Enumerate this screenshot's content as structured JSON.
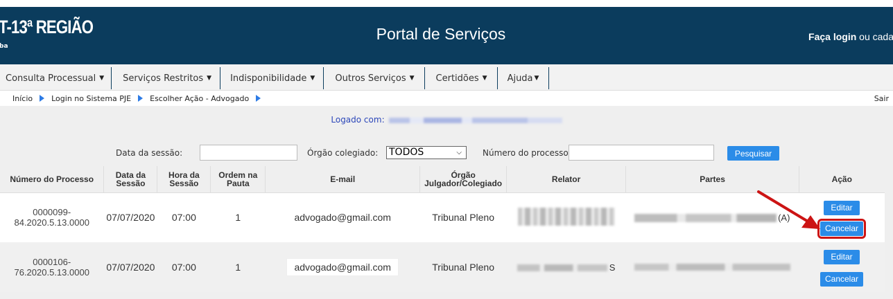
{
  "header": {
    "logo_text": "T-13ª REGIÃO",
    "logo_sub": "ba",
    "title": "Portal de Serviços",
    "login_bold": "Faça login",
    "login_rest": " ou cadas"
  },
  "nav": {
    "items": [
      {
        "label": "Consulta Processual"
      },
      {
        "label": "Serviços Restritos"
      },
      {
        "label": "Indisponibilidade"
      },
      {
        "label": "Outros Serviços"
      },
      {
        "label": "Certidões"
      },
      {
        "label": "Ajuda"
      }
    ]
  },
  "breadcrumb": {
    "items": [
      "Início",
      "Login no Sistema PJE",
      "Escolher Ação - Advogado"
    ],
    "sair": "Sair"
  },
  "logged": {
    "label": "Logado com:"
  },
  "search": {
    "date_label": "Data da sessão:",
    "date_value": "",
    "orgao_label": "Órgão colegiado:",
    "orgao_value": "TODOS",
    "numero_label": "Número do processo:",
    "numero_value": "",
    "button": "Pesquisar"
  },
  "table": {
    "headers": {
      "numero": "Número do Processo",
      "data1": "Data da",
      "data2": "Sessão",
      "hora1": "Hora da",
      "hora2": "Sessão",
      "ordem1": "Ordem na",
      "ordem2": "Pauta",
      "email": "E-mail",
      "orgao1": "Órgão",
      "orgao2": "Julgador/Colegiado",
      "relator": "Relator",
      "partes": "Partes",
      "acao": "Ação"
    },
    "rows": [
      {
        "numero1": "0000099-",
        "numero2": "84.2020.5.13.0000",
        "data": "07/07/2020",
        "hora": "07:00",
        "ordem": "1",
        "email": "advogado@gmail.com",
        "orgao": "Tribunal Pleno",
        "partes_suffix": "(A)",
        "editar": "Editar",
        "cancelar": "Cancelar"
      },
      {
        "numero1": "0000106-",
        "numero2": "76.2020.5.13.0000",
        "data": "07/07/2020",
        "hora": "07:00",
        "ordem": "1",
        "email": "advogado@gmail.com",
        "orgao": "Tribunal Pleno",
        "relator_suffix": "S",
        "editar": "Editar",
        "cancelar": "Cancelar"
      }
    ]
  },
  "colors": {
    "header_bg": "#0b3c5d",
    "button_blue": "#2b8ce8",
    "highlight_red": "#cc1414"
  }
}
